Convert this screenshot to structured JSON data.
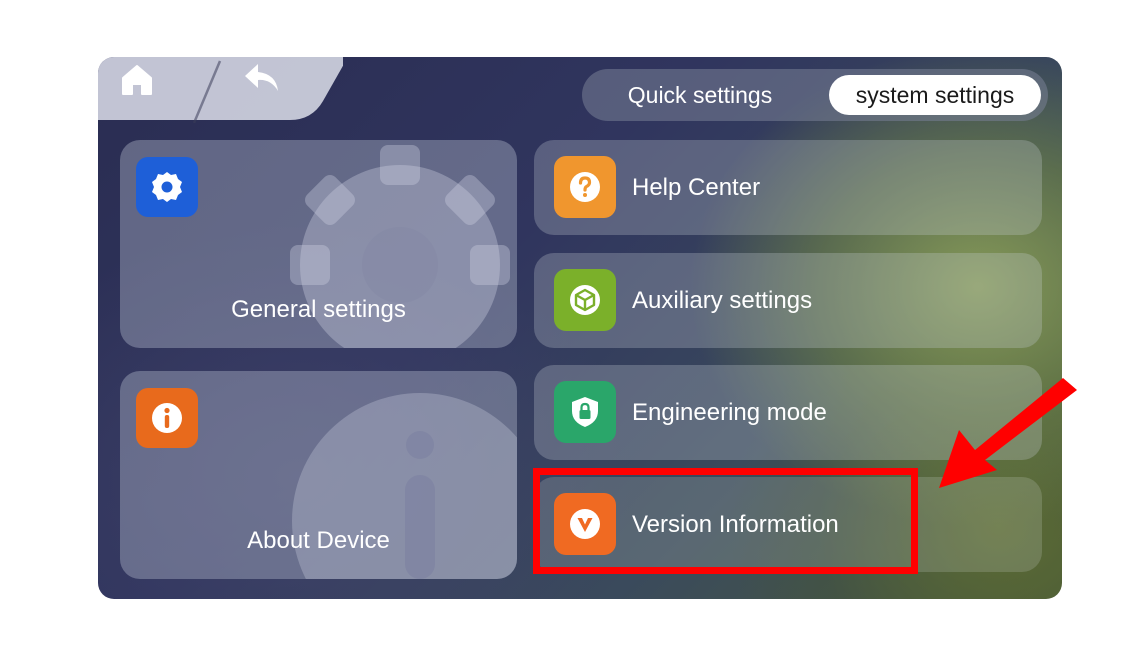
{
  "nav": {
    "home_icon": "home-icon",
    "back_icon": "back-arrow-icon"
  },
  "tabs": {
    "quick": "Quick settings",
    "system": "system settings",
    "active": "system settings"
  },
  "cards": {
    "general": {
      "label": "General settings",
      "icon": "gear-icon",
      "color": "#1e5fd8"
    },
    "about": {
      "label": "About Device",
      "icon": "info-icon",
      "color": "#e86a1c"
    }
  },
  "rows": [
    {
      "label": "Help Center",
      "icon": "question-icon",
      "color": "#f0962e"
    },
    {
      "label": "Auxiliary settings",
      "icon": "cube-icon",
      "color": "#7bb02a"
    },
    {
      "label": "Engineering mode",
      "icon": "shield-lock-icon",
      "color": "#2aa66a"
    },
    {
      "label": "Version Information",
      "icon": "version-v-icon",
      "color": "#f06a22"
    }
  ],
  "annotation": {
    "highlight_color": "#ff0000"
  }
}
